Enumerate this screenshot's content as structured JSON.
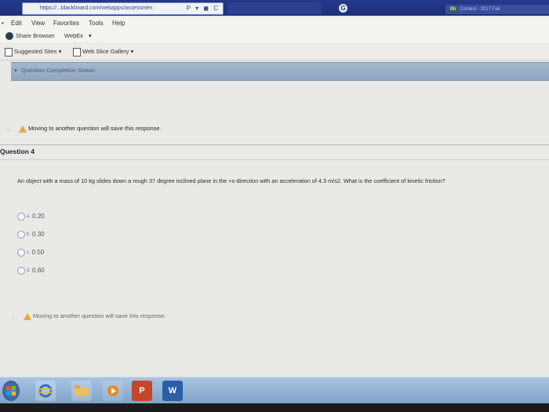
{
  "browser": {
    "address_text": "https://...blackboard.com/webapps/assessmen",
    "address_controls": "P ▾ ◼ C",
    "tab_text": "Content - 2017 Fall",
    "tab_badge": "Bb",
    "fav_circle": "G"
  },
  "menu": {
    "items": [
      "Edit",
      "View",
      "Favorites",
      "Tools",
      "Help"
    ]
  },
  "commands": {
    "share_browser": "Share Browser",
    "webex": "WebEx",
    "webex_arrow": "▾"
  },
  "favorites": {
    "suggested_sites": "Suggested Sites",
    "web_slice_gallery": "Web Slice Gallery",
    "arrow": "▾"
  },
  "completion": {
    "label": "Question Completion Status:",
    "chevron": "▾"
  },
  "notice_top": "Moving to another question will save this response.",
  "question": {
    "header": "Question 4",
    "text": "An object with a mass of 10 kg slides down a rough 37 degree inclined plane in the +x-direction with an acceleration of 4.3 m/s2. What is the coefficient of kinetic friction?",
    "options": [
      {
        "letter": "a.",
        "value": "0.20"
      },
      {
        "letter": "b.",
        "value": "0.30"
      },
      {
        "letter": "c.",
        "value": "0.50"
      },
      {
        "letter": "d.",
        "value": "0.60"
      }
    ]
  },
  "notice_bottom": "Moving to another question will save this response.",
  "taskbar": {
    "powerpoint": "P",
    "word": "W"
  }
}
